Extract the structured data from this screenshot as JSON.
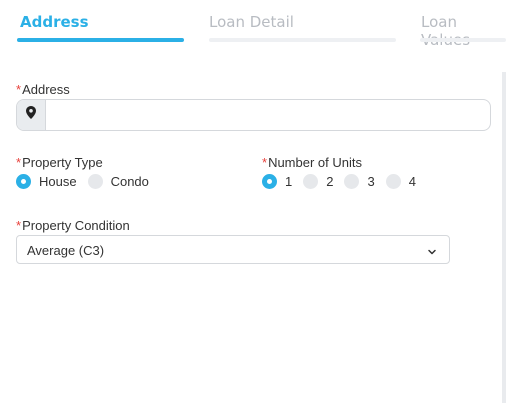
{
  "tabs": [
    {
      "label": "Address",
      "active": true
    },
    {
      "label": "Loan Detail",
      "active": false
    },
    {
      "label": "Loan Values",
      "active": false
    }
  ],
  "required_marker": "*",
  "address": {
    "label": "Address",
    "icon": "map-pin-icon",
    "value": "",
    "placeholder": ""
  },
  "property_type": {
    "label": "Property Type",
    "options": [
      "House",
      "Condo"
    ],
    "selected": "House"
  },
  "number_of_units": {
    "label": "Number of Units",
    "options": [
      "1",
      "2",
      "3",
      "4"
    ],
    "selected": "1"
  },
  "property_condition": {
    "label": "Property Condition",
    "selected": "Average (C3)",
    "icon": "chevron-down-icon"
  },
  "colors": {
    "accent": "#2bb0e6",
    "required": "#e8413c",
    "inactive_tab": "#b8bcc2"
  }
}
